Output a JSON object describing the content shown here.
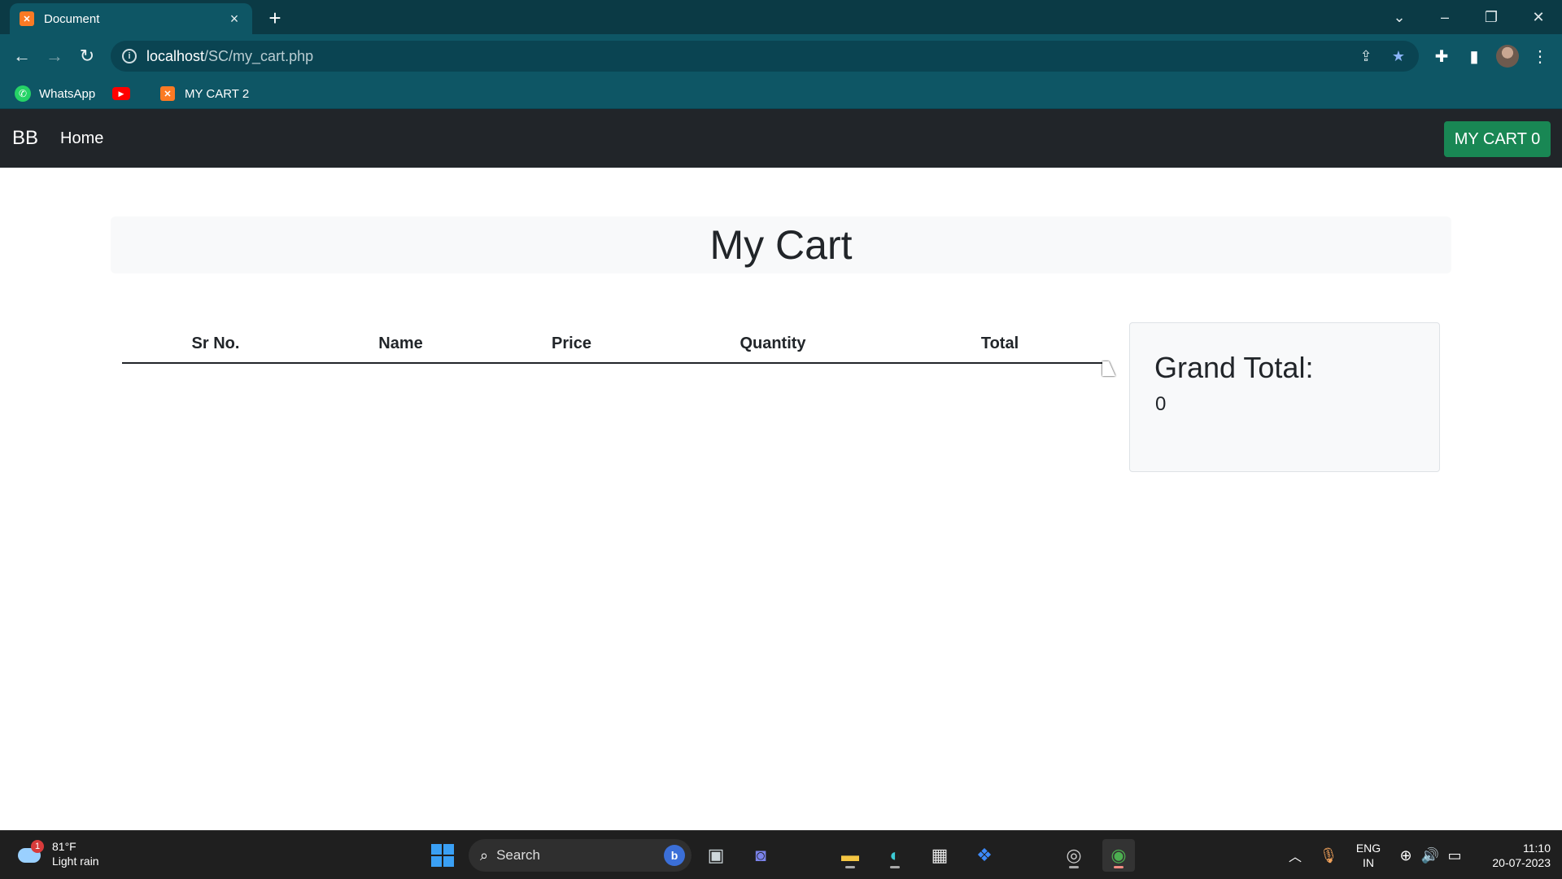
{
  "browser": {
    "tab_title": "Document",
    "tab_favicon": "xampp-icon",
    "new_tab_label": "+",
    "url_host": "localhost",
    "url_path": "/SC/my_cart.php",
    "bookmarks": [
      {
        "label": "WhatsApp",
        "icon": "whatsapp-icon"
      },
      {
        "label": "",
        "icon": "youtube-icon"
      },
      {
        "label": "MY CART 2",
        "icon": "xampp-icon"
      }
    ]
  },
  "navbar": {
    "brand": "BB",
    "home_link": "Home",
    "cart_button": "MY CART 0",
    "cart_button_color": "#198754"
  },
  "main": {
    "heading": "My Cart",
    "table_headers": [
      "Sr No.",
      "Name",
      "Price",
      "Quantity",
      "Total"
    ],
    "table_rows": [],
    "grand_total_label": "Grand Total:",
    "grand_total_value": "0"
  },
  "taskbar": {
    "weather_temp": "81°F",
    "weather_desc": "Light rain",
    "weather_badge": "1",
    "search_placeholder": "Search",
    "lang_line1": "ENG",
    "lang_line2": "IN",
    "time": "11:10",
    "date": "20-07-2023"
  }
}
